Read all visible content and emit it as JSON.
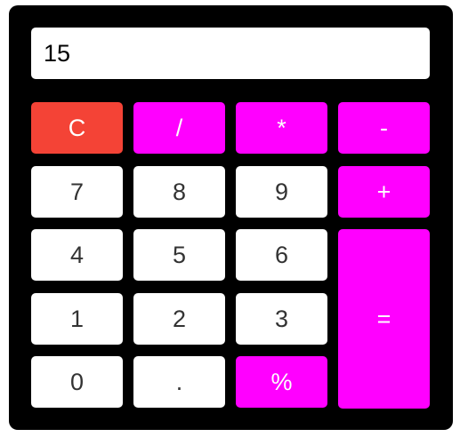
{
  "display": {
    "value": "15"
  },
  "colors": {
    "frame": "#000000",
    "display_bg": "#ffffff",
    "number_key_bg": "#ffffff",
    "number_key_text": "#333333",
    "operator_key_bg": "#ff00ff",
    "operator_key_text": "#ffffff",
    "clear_key_bg": "#f44336"
  },
  "keys": {
    "clear": "C",
    "divide": "/",
    "multiply": "*",
    "subtract": "-",
    "add": "+",
    "equals": "=",
    "percent": "%",
    "decimal": ".",
    "d0": "0",
    "d1": "1",
    "d2": "2",
    "d3": "3",
    "d4": "4",
    "d5": "5",
    "d6": "6",
    "d7": "7",
    "d8": "8",
    "d9": "9"
  }
}
